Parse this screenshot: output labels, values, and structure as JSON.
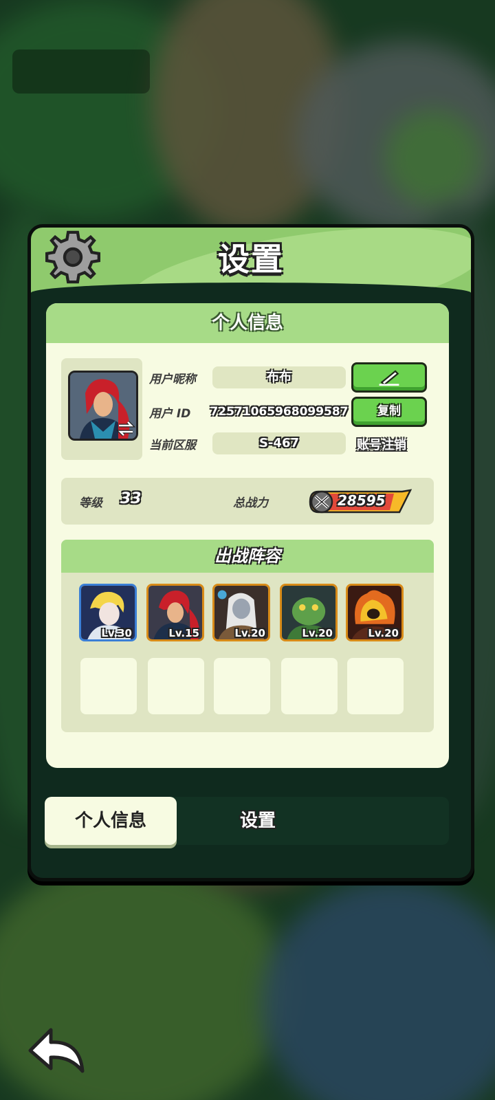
{
  "dialog": {
    "title": "设置",
    "icon": "gear-icon"
  },
  "profile": {
    "section_title": "个人信息",
    "nickname_label": "用户昵称",
    "nickname_value": "布布",
    "edit_icon": "pencil-icon",
    "id_label": "用户 ID",
    "id_value": "7257106596809958​7",
    "copy_label": "复制",
    "server_label": "当前区服",
    "server_value": "S-467",
    "cancel_account_label": "账号注销",
    "avatar_icon": "avatar-swap-icon"
  },
  "stats": {
    "level_label": "等级",
    "level_value": "33",
    "power_label": "总战力",
    "power_value": "28595"
  },
  "lineup": {
    "title": "出战阵容",
    "heroes": [
      {
        "level": "Lv.30",
        "frame": "#3b7fd6"
      },
      {
        "level": "Lv.15",
        "frame": "#d88b18"
      },
      {
        "level": "Lv.20",
        "frame": "#d88b18"
      },
      {
        "level": "Lv.20",
        "frame": "#d88b18"
      },
      {
        "level": "Lv.20",
        "frame": "#d88b18"
      }
    ]
  },
  "tabs": {
    "personal": "个人信息",
    "settings": "设置"
  },
  "colors": {
    "accent_green": "#6bd24f",
    "header_green": "#8fca6d",
    "panel_bg": "#f7fbe2"
  }
}
